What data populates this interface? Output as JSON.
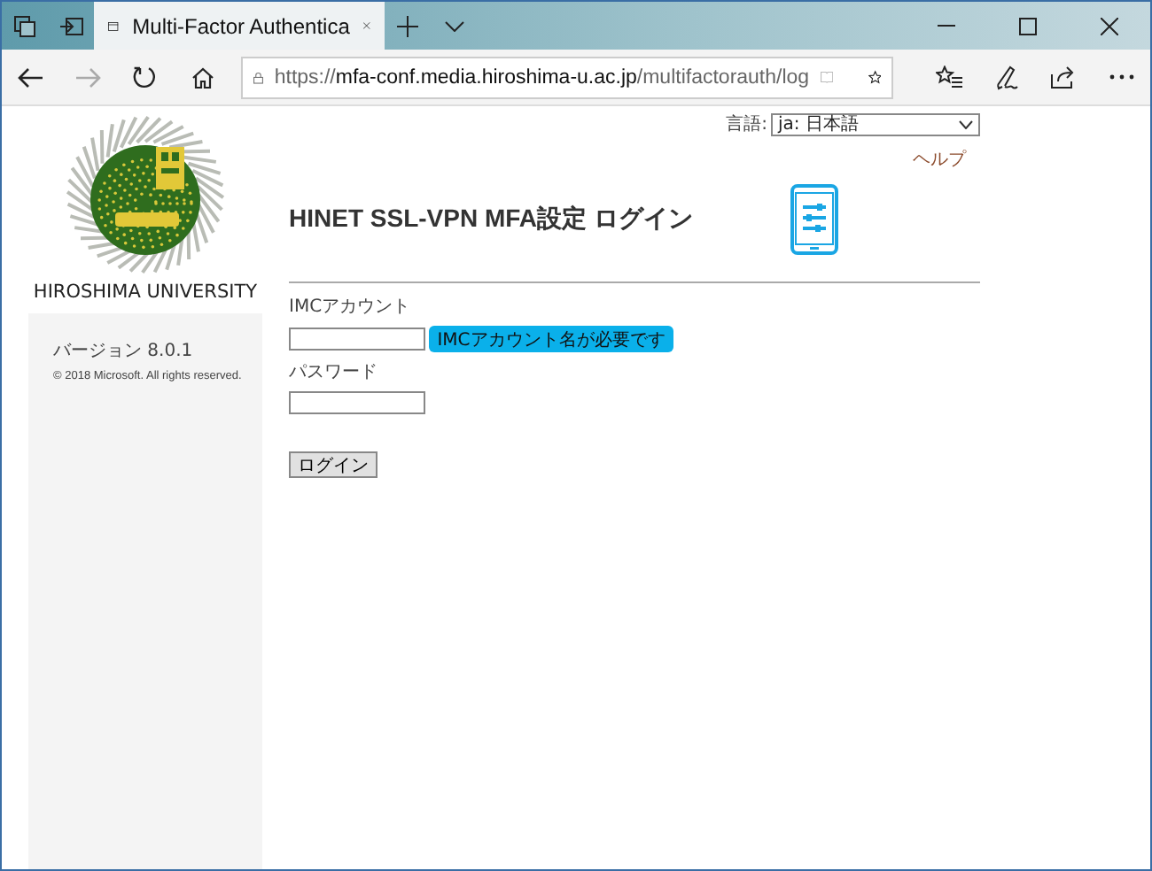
{
  "browser": {
    "tab_title": "Multi-Factor Authentica",
    "url_scheme": "https://",
    "url_host": "mfa-conf.media.hiroshima-u.ac.jp",
    "url_path": "/multifactorauth/log"
  },
  "sidebar": {
    "university": "HIROSHIMA UNIVERSITY",
    "version": "バージョン 8.0.1",
    "copyright": "© 2018 Microsoft. All rights reserved."
  },
  "language": {
    "label": "言語:",
    "value": "ja: 日本語"
  },
  "help": "ヘルプ",
  "title": "HINET SSL-VPN MFA設定 ログイン",
  "form": {
    "account_label": "IMCアカウント",
    "account_error": "IMCアカウント名が必要です",
    "password_label": "パスワード",
    "login_button": "ログイン"
  }
}
